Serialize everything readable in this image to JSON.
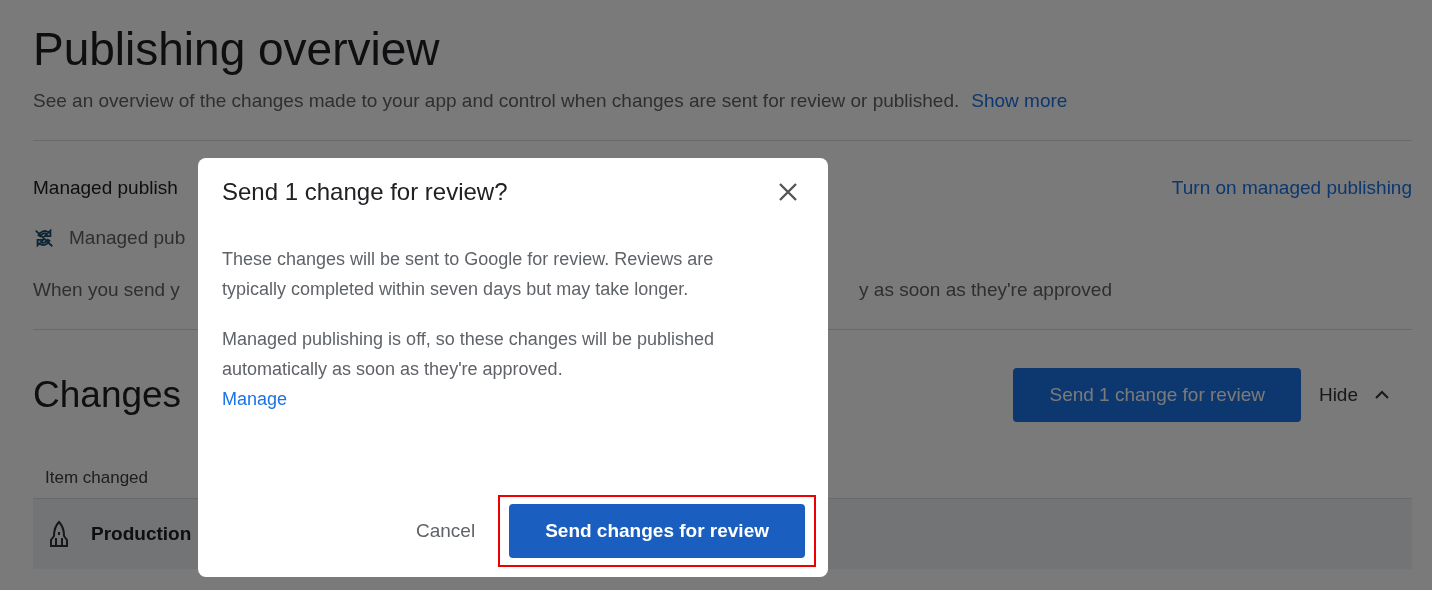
{
  "page": {
    "title": "Publishing overview",
    "description": "See an overview of the changes made to your app and control when changes are sent for review or published.",
    "description_link": "Show more",
    "managed_publishing": {
      "heading": "Managed publish",
      "action_link": "Turn on managed publishing",
      "status": "Managed pub",
      "note_start": "When you send y",
      "note_end": "y as soon as they're approved"
    },
    "changes": {
      "heading": "Changes",
      "send_button": "Send 1 change for review",
      "toggle": {
        "label": "Hide",
        "expanded": true
      },
      "table": {
        "columns": [
          "Item changed"
        ],
        "rows": [
          {
            "item": "Production"
          }
        ]
      }
    }
  },
  "dialog": {
    "title": "Send 1 change for review?",
    "paragraphs": [
      "These changes will be sent to Google for review. Reviews are typically completed within seven days but may take longer.",
      "Managed publishing is off, so these changes will be published automatically as soon as they're approved."
    ],
    "link": "Manage",
    "buttons": [
      {
        "label": "Cancel",
        "kind": "text",
        "highlighted": false
      },
      {
        "label": "Send changes for review",
        "kind": "primary",
        "highlighted": true
      }
    ]
  }
}
